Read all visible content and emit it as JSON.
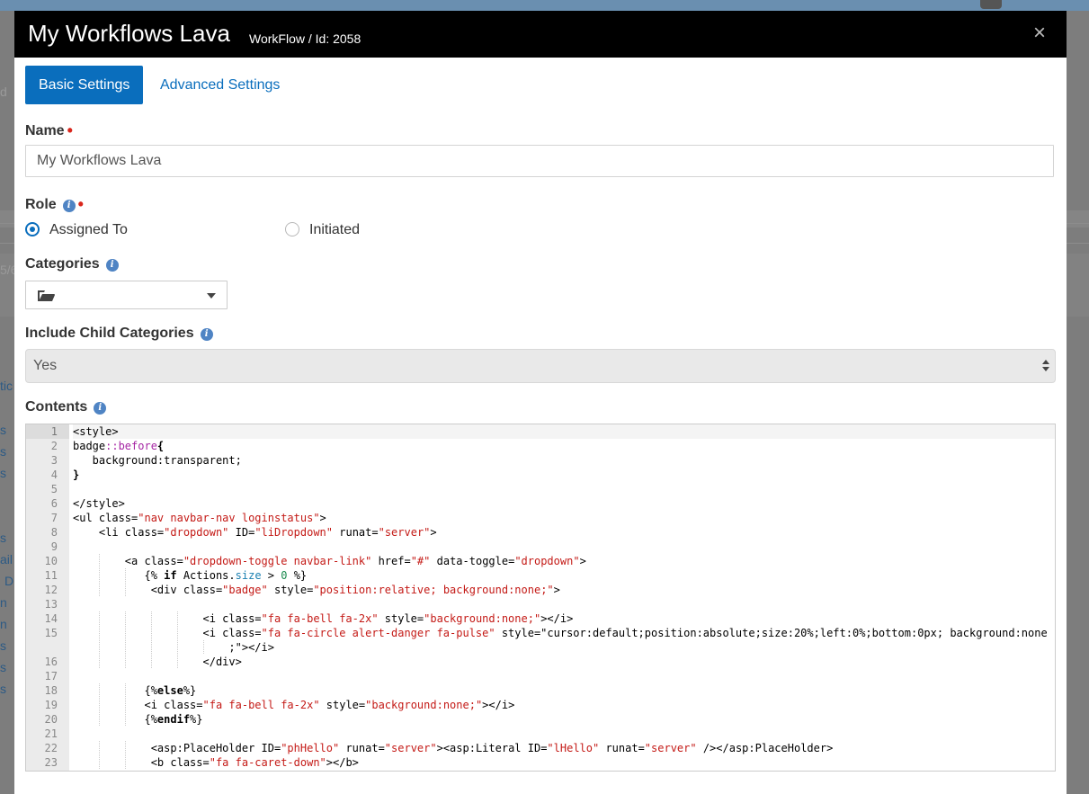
{
  "modal": {
    "title": "My Workflows Lava",
    "subtitle": "WorkFlow / Id: 2058",
    "close_glyph": "×"
  },
  "tabs": [
    {
      "label": "Basic Settings",
      "active": true
    },
    {
      "label": "Advanced Settings",
      "active": false
    }
  ],
  "form": {
    "name_label": "Name",
    "name_value": "My Workflows Lava",
    "role_label": "Role",
    "role_options": [
      {
        "label": "Assigned To",
        "checked": true
      },
      {
        "label": "Initiated",
        "checked": false
      }
    ],
    "categories_label": "Categories",
    "include_child_label": "Include Child Categories",
    "include_child_value": "Yes",
    "contents_label": "Contents"
  },
  "icons": {
    "info": "info-circle-icon",
    "folder": "folder-open-icon",
    "caret": "caret-down-icon",
    "close": "close-icon"
  },
  "colors": {
    "accent": "#0a6ebd",
    "header_bg": "#000000",
    "required": "#d9261c",
    "info": "#4f84c4"
  },
  "background_fragments": [
    "d",
    "5/6",
    "tic",
    "s",
    "s",
    "s",
    "s",
    "ail",
    "D",
    "n",
    "n",
    "s",
    "s",
    "s"
  ],
  "code_lines": [
    {
      "n": "1",
      "text": "<style>"
    },
    {
      "n": "2",
      "text": "badge::before{"
    },
    {
      "n": "3",
      "text": "   background:transparent;"
    },
    {
      "n": "4",
      "text": "}"
    },
    {
      "n": "5",
      "text": ""
    },
    {
      "n": "6",
      "text": "</style>"
    },
    {
      "n": "7",
      "text": "<ul class=\"nav navbar-nav loginstatus\">"
    },
    {
      "n": "8",
      "text": "    <li class=\"dropdown\" ID=\"liDropdown\" runat=\"server\">"
    },
    {
      "n": "9",
      "text": ""
    },
    {
      "n": "10",
      "text": "        <a class=\"dropdown-toggle navbar-link\" href=\"#\" data-toggle=\"dropdown\">"
    },
    {
      "n": "11",
      "text": "           {% if Actions.size > 0 %}"
    },
    {
      "n": "12",
      "text": "            <div class=\"badge\" style=\"position:relative; background:none;\">"
    },
    {
      "n": "13",
      "text": ""
    },
    {
      "n": "14",
      "text": "                    <i class=\"fa fa-bell fa-2x\" style=\"background:none;\"></i>"
    },
    {
      "n": "15",
      "text": "                    <i class=\"fa fa-circle alert-danger fa-pulse\" style=\"cursor:default;position:absolute;size:20%;left:0%;bottom:0px; background:none"
    },
    {
      "n": "",
      "text": "                        ;\"></i>"
    },
    {
      "n": "16",
      "text": "                    </div>"
    },
    {
      "n": "17",
      "text": ""
    },
    {
      "n": "18",
      "text": "           {%else%}"
    },
    {
      "n": "19",
      "text": "           <i class=\"fa fa-bell fa-2x\" style=\"background:none;\"></i>"
    },
    {
      "n": "20",
      "text": "           {%endif%}"
    },
    {
      "n": "21",
      "text": ""
    },
    {
      "n": "22",
      "text": "            <asp:PlaceHolder ID=\"phHello\" runat=\"server\"><asp:Literal ID=\"lHello\" runat=\"server\" /></asp:PlaceHolder>"
    },
    {
      "n": "23",
      "text": "            <b class=\"fa fa-caret-down\"></b>"
    }
  ]
}
